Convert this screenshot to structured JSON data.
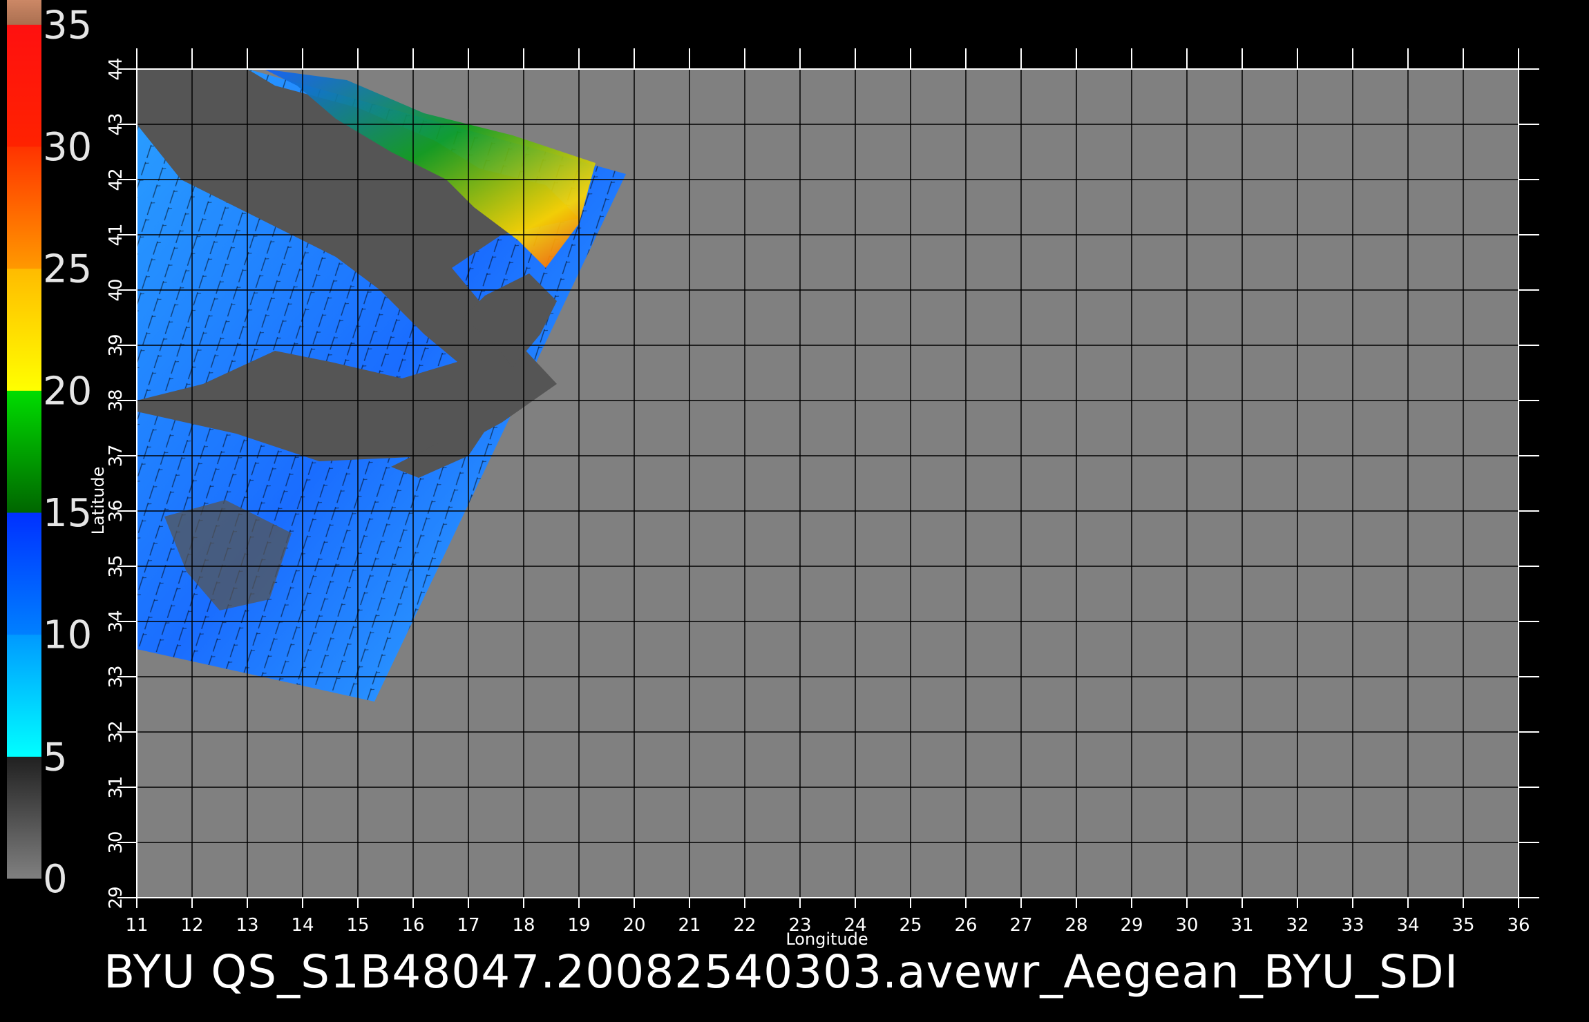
{
  "caption": "BYU  QS_S1B48047.20082540303.avewr_Aegean_BYU_SDI",
  "map": {
    "xlabel": "Longitude",
    "ylabel": "Latitude",
    "lon_range": [
      11,
      36
    ],
    "lat_range": [
      29,
      44
    ],
    "lon_ticks": [
      11,
      12,
      13,
      14,
      15,
      16,
      17,
      18,
      19,
      20,
      21,
      22,
      23,
      24,
      25,
      26,
      27,
      28,
      29,
      30,
      31,
      32,
      33,
      34,
      35,
      36
    ],
    "lat_ticks": [
      29,
      30,
      31,
      32,
      33,
      34,
      35,
      36,
      37,
      38,
      39,
      40,
      41,
      42,
      43,
      44
    ],
    "grid": true,
    "background_color": "#808080",
    "land_color": "#555555"
  },
  "colorbar": {
    "labels": [
      "35",
      "30",
      "25",
      "20",
      "15",
      "10",
      "5",
      "0"
    ],
    "segments": [
      {
        "from": 0,
        "to": 5,
        "colors": [
          "#808080",
          "#202020"
        ]
      },
      {
        "from": 5,
        "to": 10,
        "colors": [
          "#00ffff",
          "#0099ff"
        ]
      },
      {
        "from": 10,
        "to": 15,
        "colors": [
          "#0080ff",
          "#0030ff"
        ]
      },
      {
        "from": 15,
        "to": 20,
        "colors": [
          "#006600",
          "#00dd00"
        ]
      },
      {
        "from": 20,
        "to": 25,
        "colors": [
          "#ffff00",
          "#ffbb00"
        ]
      },
      {
        "from": 25,
        "to": 30,
        "colors": [
          "#ff9900",
          "#ff3300"
        ]
      },
      {
        "from": 30,
        "to": 35,
        "colors": [
          "#ff2200",
          "#ff1010"
        ]
      },
      {
        "from": 35,
        "to": 36,
        "colors": [
          "#aa6f50",
          "#cc8866"
        ]
      }
    ]
  },
  "swath": {
    "corners_lonlat": [
      [
        11,
        44
      ],
      [
        13.0,
        44
      ],
      [
        19.85,
        42.1
      ],
      [
        15.3,
        32.55
      ],
      [
        11,
        33.5
      ]
    ]
  }
}
